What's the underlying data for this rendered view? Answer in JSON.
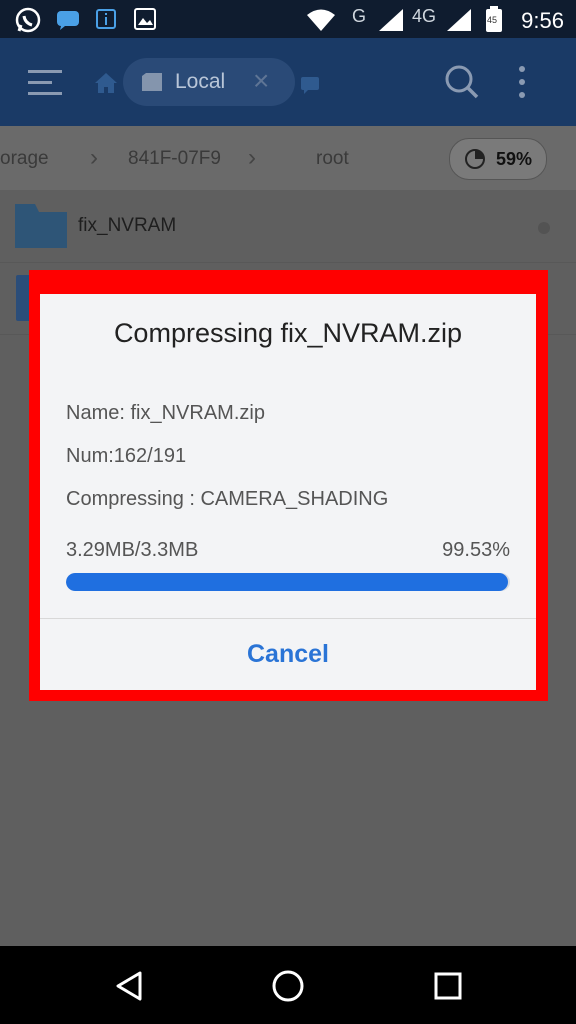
{
  "status_bar": {
    "time": "9:56",
    "network_g": "G",
    "network_4g": "4G",
    "battery_level": "45",
    "icons": [
      "whatsapp-icon",
      "chat-icon",
      "info-icon",
      "gallery-icon",
      "wifi-icon",
      "signal-icon",
      "battery-icon"
    ]
  },
  "toolbar": {
    "tab_label": "Local"
  },
  "breadcrumb": {
    "items": [
      "orage",
      "841F-07F9",
      "root"
    ],
    "storage_percent": "59%"
  },
  "files": [
    {
      "name": "fix_NVRAM"
    }
  ],
  "dialog": {
    "title": "Compressing fix_NVRAM.zip",
    "name_line": "Name: fix_NVRAM.zip",
    "num_line": "Num:162/191",
    "compressing_line": "Compressing : CAMERA_SHADING",
    "size_progress": "3.29MB/3.3MB",
    "percent": "99.53%",
    "progress_fraction": 0.9953,
    "cancel_label": "Cancel"
  },
  "colors": {
    "accent": "#2a74d6",
    "progress": "#1f6fe0",
    "highlight": "#ff0000",
    "toolbar": "#1a3a66"
  }
}
